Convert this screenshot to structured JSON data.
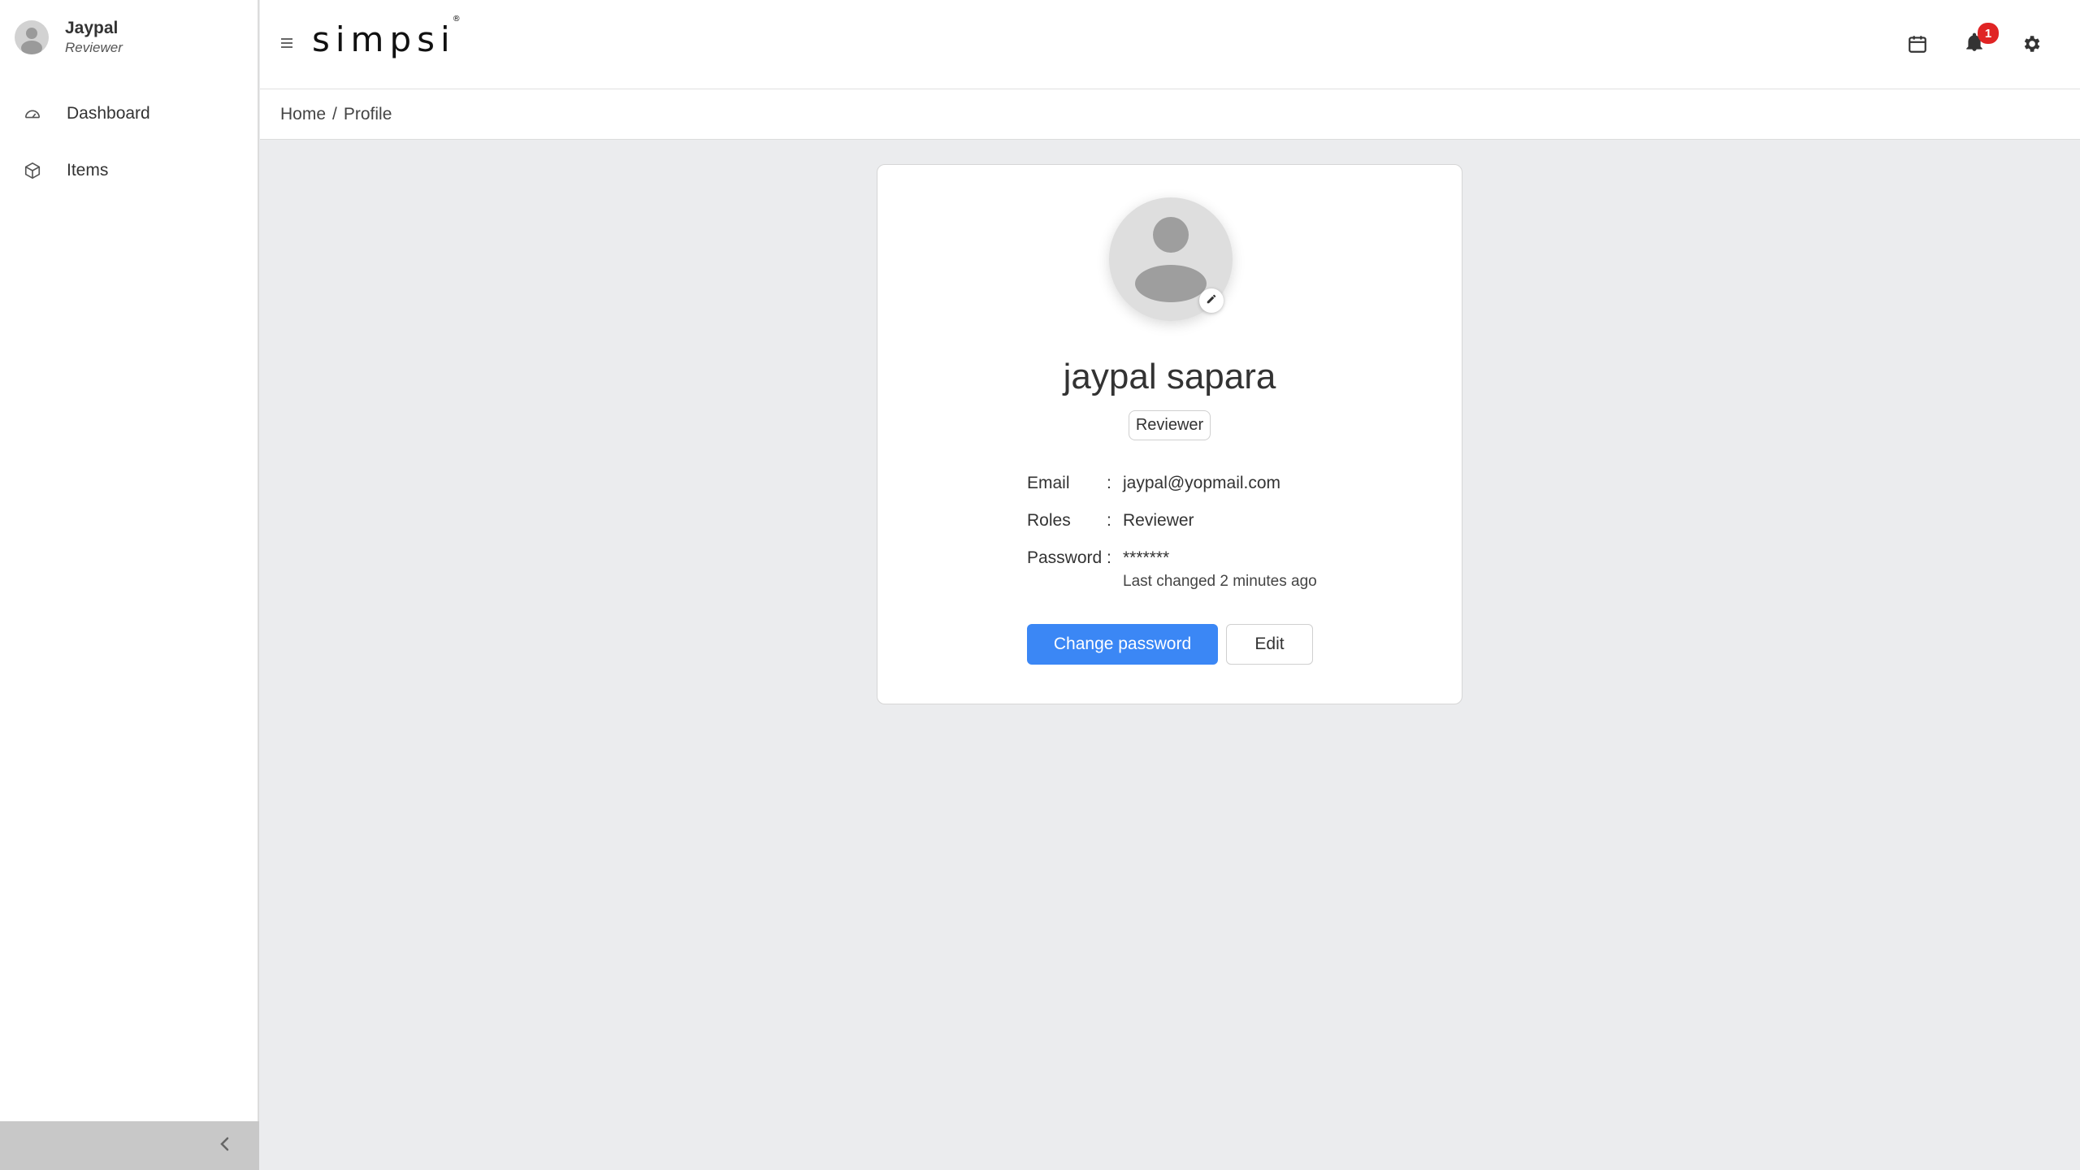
{
  "sidebar": {
    "user": {
      "name": "Jaypal",
      "role": "Reviewer"
    },
    "items": [
      {
        "label": "Dashboard",
        "icon": "dashboard-gauge-icon"
      },
      {
        "label": "Items",
        "icon": "cube-icon"
      }
    ],
    "collapse_icon": "chevron-left-icon"
  },
  "header": {
    "logo": "simpsi",
    "logo_mark": "®",
    "notification_count": "1",
    "icons": [
      "calendar-icon",
      "bell-icon",
      "gear-icon"
    ]
  },
  "breadcrumb": {
    "home": "Home",
    "separator": "/",
    "current": "Profile"
  },
  "profile": {
    "full_name": "jaypal sapara",
    "role_badge": "Reviewer",
    "fields": {
      "email_label": "Email",
      "email_value": "jaypal@yopmail.com",
      "roles_label": "Roles",
      "roles_value": "Reviewer",
      "password_label": "Password",
      "password_value": "*******",
      "password_changed": "Last changed 2 minutes ago",
      "colon": ":"
    },
    "buttons": {
      "change_password": "Change password",
      "edit": "Edit"
    }
  },
  "colors": {
    "primary": "#3b87f5",
    "badge": "#e02424",
    "background": "#ebecee"
  }
}
